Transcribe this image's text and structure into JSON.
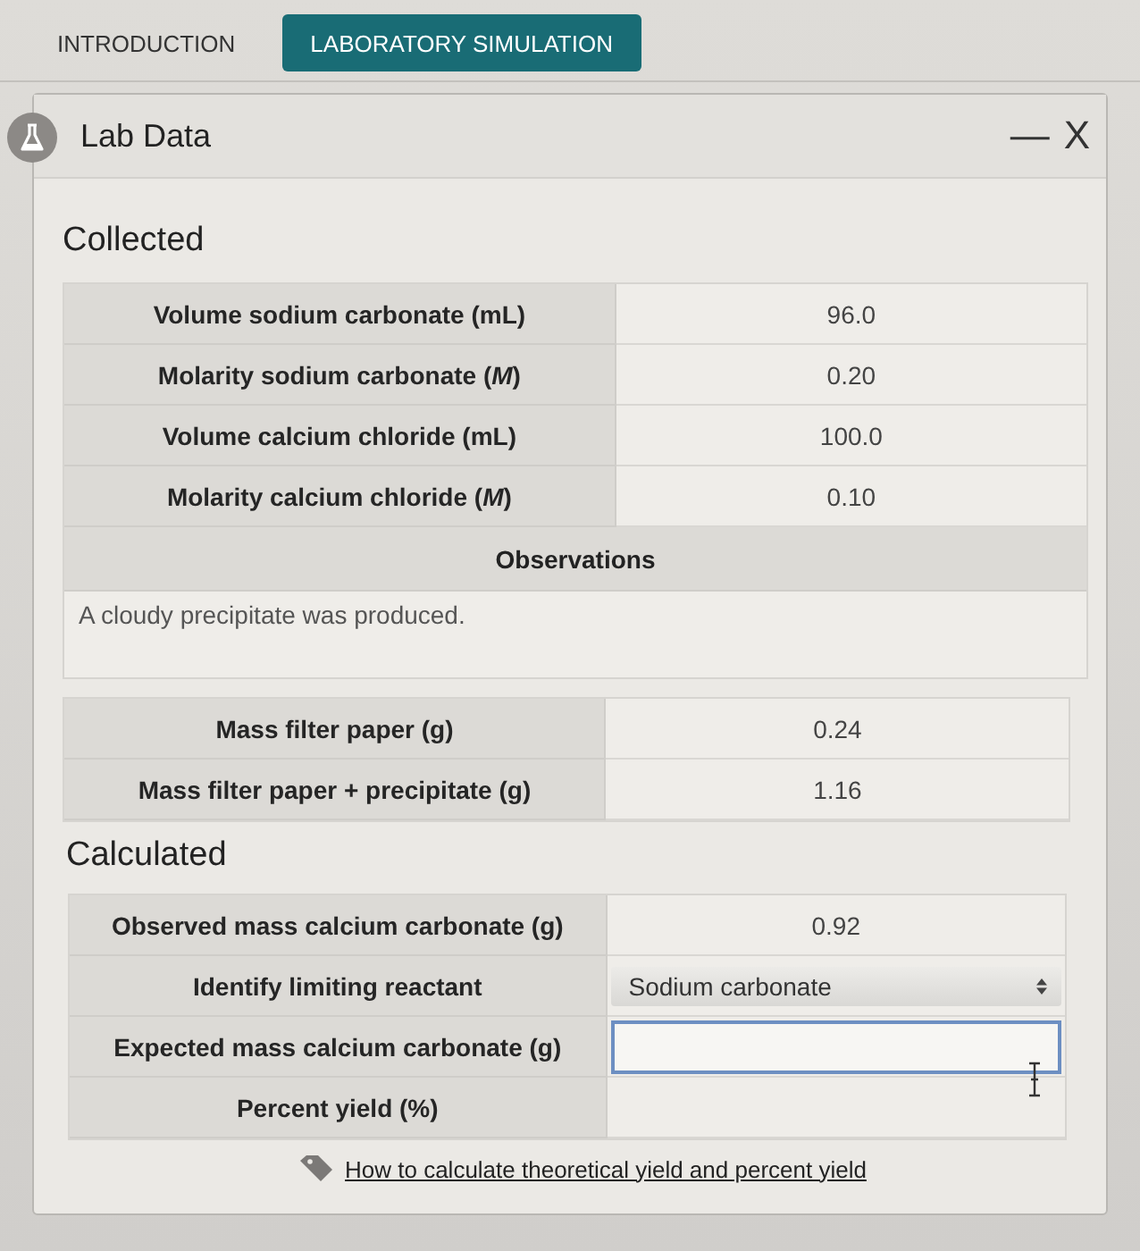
{
  "tabs": [
    {
      "label": "INTRODUCTION",
      "selected": false
    },
    {
      "label": "LABORATORY SIMULATION",
      "selected": true
    }
  ],
  "panel": {
    "title": "Lab Data",
    "minimize_label": "—",
    "close_label": "X"
  },
  "collected": {
    "heading": "Collected",
    "rows": [
      {
        "label": "Volume sodium carbonate (mL)",
        "value": "96.0"
      },
      {
        "label": "Molarity sodium carbonate (*M*)",
        "value": "0.20"
      },
      {
        "label": "Volume calcium chloride (mL)",
        "value": "100.0"
      },
      {
        "label": "Molarity calcium chloride (*M*)",
        "value": "0.10"
      }
    ],
    "observations_heading": "Observations",
    "observations_text": "A cloudy precipitate was produced.",
    "mass_rows": [
      {
        "label": "Mass filter paper (g)",
        "value": "0.24"
      },
      {
        "label": "Mass filter paper + precipitate (g)",
        "value": "1.16"
      }
    ]
  },
  "calculated": {
    "heading": "Calculated",
    "rows": [
      {
        "kind": "value",
        "label": "Observed mass calcium carbonate (g)",
        "value": "0.92"
      },
      {
        "kind": "select",
        "label": "Identify limiting reactant",
        "value": "Sodium carbonate"
      },
      {
        "kind": "input",
        "label": "Expected mass calcium carbonate (g)",
        "focused": true
      },
      {
        "kind": "value",
        "label": "Percent yield (%)"
      }
    ]
  },
  "help_link": {
    "text": "How to calculate theoretical yield and percent yield"
  }
}
